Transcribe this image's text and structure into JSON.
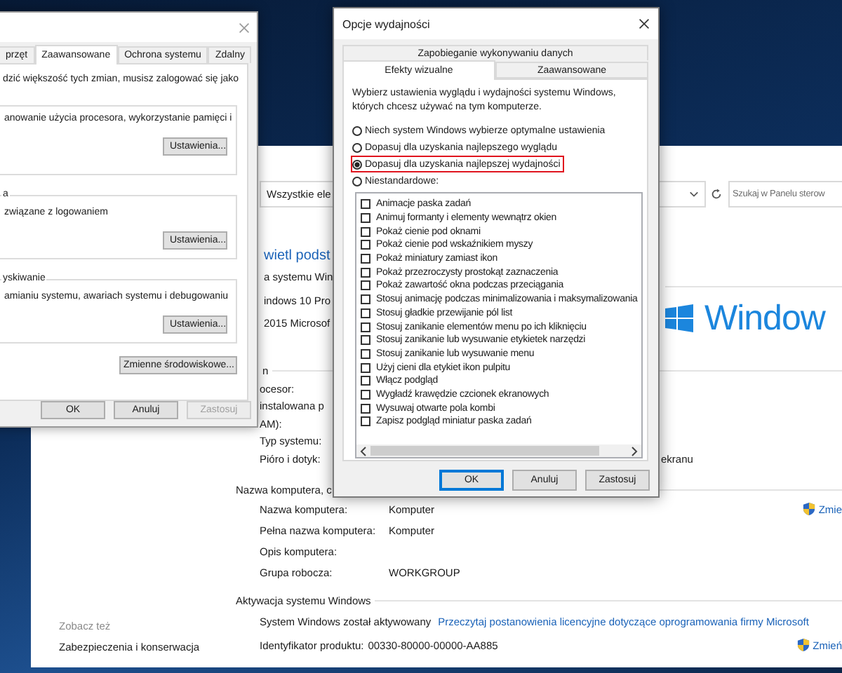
{
  "control_panel": {
    "address": "Wszystkie ele",
    "search": {
      "placeholder": "Szukaj w Panelu sterow"
    },
    "heading": "wietl podst",
    "edition_lines": [
      "a systemu Win",
      "indows 10 Pro",
      "2015 Microsof"
    ],
    "brand_text": "Window",
    "system_section": {
      "title": "n",
      "rows": [
        {
          "label": "ocesor:"
        },
        {
          "label": "instalowana p"
        },
        {
          "label": "AM):"
        },
        {
          "label": "Typ systemu:"
        },
        {
          "label": "Pióro i dotyk:",
          "value": "ekranu"
        }
      ]
    },
    "computer_section": {
      "title": "Nazwa komputera, c",
      "change_link": "Zmie",
      "rows": [
        {
          "label": "Nazwa komputera:",
          "value": "Komputer"
        },
        {
          "label": "Pełna nazwa komputera:",
          "value": "Komputer"
        },
        {
          "label": "Opis komputera:"
        },
        {
          "label": "Grupa robocza:",
          "value": "WORKGROUP"
        }
      ]
    },
    "activation_section": {
      "title": "Aktywacja systemu Windows",
      "status": "System Windows został aktywowany",
      "license_link": "Przeczytaj postanowienia licencyjne dotyczące oprogramowania firmy Microsoft",
      "product_label": "Identyfikator produktu:",
      "product_id": "00330-80000-00000-AA885",
      "change_link": "Zmień"
    },
    "see_also": {
      "title": "Zobacz też",
      "links": [
        "Zabezpieczenia i konserwacja"
      ]
    }
  },
  "system_properties": {
    "tabs": [
      {
        "label": "przęt",
        "selected": false
      },
      {
        "label": "Zaawansowane",
        "selected": true
      },
      {
        "label": "Ochrona systemu",
        "selected": false
      },
      {
        "label": "Zdalny",
        "selected": false
      }
    ],
    "note": "dzić większość tych zmian, musisz zalogować się jako",
    "groups": [
      {
        "text": "anowanie użycia procesora, wykorzystanie pamięci i",
        "button": "Ustawienia..."
      },
      {
        "title": "a",
        "text": "związane z logowaniem",
        "button": "Ustawienia..."
      },
      {
        "title": "yskiwanie",
        "text": "amianiu systemu, awariach systemu i debugowaniu",
        "button": "Ustawienia..."
      }
    ],
    "env_button": "Zmienne środowiskowe...",
    "buttons": [
      {
        "label": "OK",
        "disabled": false
      },
      {
        "label": "Anuluj",
        "disabled": false
      },
      {
        "label": "Zastosuj",
        "disabled": true
      }
    ]
  },
  "performance_options": {
    "title": "Opcje wydajności",
    "back_tabs": [
      {
        "label": "Zapobieganie wykonywaniu danych",
        "selected": false
      }
    ],
    "tabs": [
      {
        "label": "Efekty wizualne",
        "selected": true
      },
      {
        "label": "Zaawansowane",
        "selected": false
      }
    ],
    "description": "Wybierz ustawienia wyglądu i wydajności systemu Windows, których chcesz używać na tym komputerze.",
    "radios": [
      {
        "label": "Niech system Windows wybierze optymalne ustawienia",
        "selected": false,
        "highlighted": false
      },
      {
        "label": "Dopasuj dla uzyskania najlepszego wyglądu",
        "selected": false,
        "highlighted": false
      },
      {
        "label": "Dopasuj dla uzyskania najlepszej wydajności",
        "selected": true,
        "highlighted": true
      },
      {
        "label": "Niestandardowe:",
        "selected": false,
        "highlighted": false
      }
    ],
    "effects": [
      {
        "label": "Animacje paska zadań",
        "checked": false
      },
      {
        "label": "Animuj formanty i elementy wewnątrz okien",
        "checked": false
      },
      {
        "label": "Pokaż cienie pod oknami",
        "checked": false
      },
      {
        "label": "Pokaż cienie pod wskaźnikiem myszy",
        "checked": false
      },
      {
        "label": "Pokaż miniatury zamiast ikon",
        "checked": false
      },
      {
        "label": "Pokaż przezroczysty prostokąt zaznaczenia",
        "checked": false
      },
      {
        "label": "Pokaż zawartość okna podczas przeciągania",
        "checked": false
      },
      {
        "label": "Stosuj animację podczas minimalizowania i maksymalizowania",
        "checked": false
      },
      {
        "label": "Stosuj gładkie przewijanie pól list",
        "checked": false
      },
      {
        "label": "Stosuj zanikanie elementów menu po ich kliknięciu",
        "checked": false
      },
      {
        "label": "Stosuj zanikanie lub wysuwanie etykietek narzędzi",
        "checked": false
      },
      {
        "label": "Stosuj zanikanie lub wysuwanie menu",
        "checked": false
      },
      {
        "label": "Użyj cieni dla etykiet ikon pulpitu",
        "checked": false
      },
      {
        "label": "Włącz podgląd",
        "checked": false
      },
      {
        "label": "Wygładź krawędzie czcionek ekranowych",
        "checked": false
      },
      {
        "label": "Wysuwaj otwarte pola kombi",
        "checked": false
      },
      {
        "label": "Zapisz podgląd miniatur paska zadań",
        "checked": false
      }
    ],
    "buttons": [
      {
        "label": "OK",
        "default": true
      },
      {
        "label": "Anuluj",
        "default": false
      },
      {
        "label": "Zastosuj",
        "default": false
      }
    ]
  }
}
